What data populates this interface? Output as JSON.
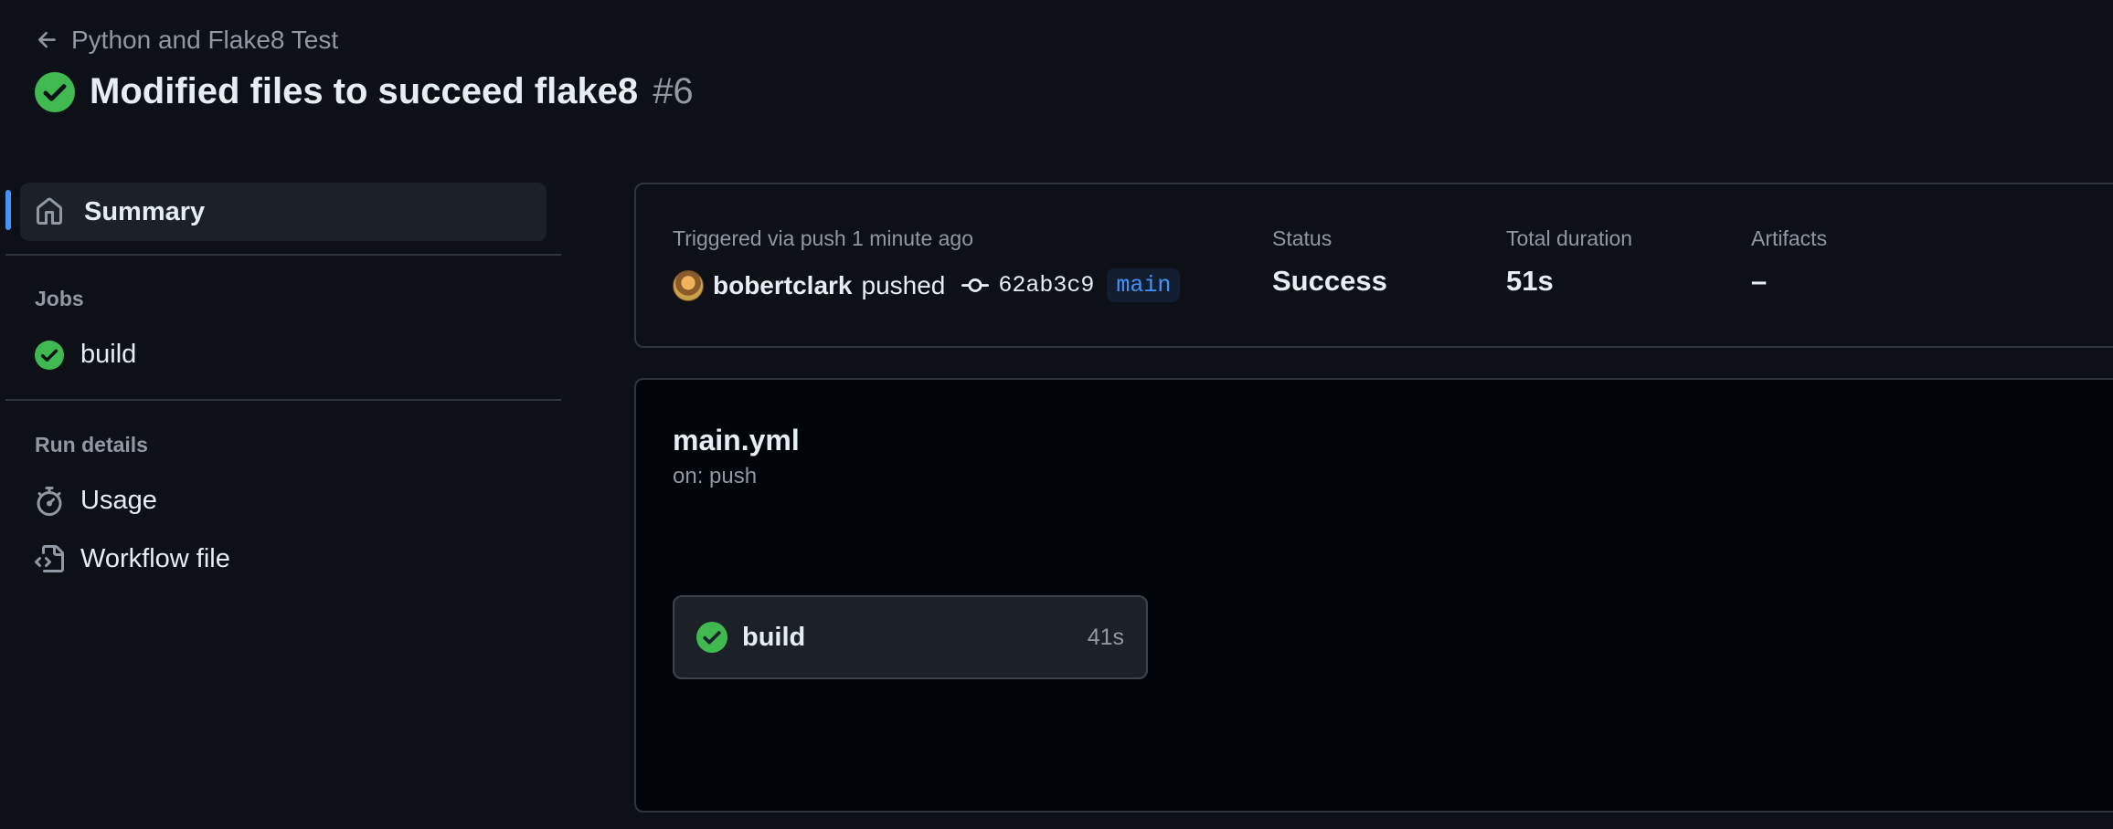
{
  "header": {
    "back_label": "Python and Flake8 Test",
    "run_title": "Modified files to succeed flake8",
    "run_number": "#6"
  },
  "sidebar": {
    "summary_label": "Summary",
    "jobs_heading": "Jobs",
    "jobs": [
      {
        "label": "build",
        "status": "success"
      }
    ],
    "run_details_heading": "Run details",
    "run_details": [
      {
        "label": "Usage",
        "icon": "stopwatch-icon"
      },
      {
        "label": "Workflow file",
        "icon": "file-code-icon"
      }
    ]
  },
  "summary": {
    "trigger_text": "Triggered via push 1 minute ago",
    "actor": "bobertclark",
    "action": "pushed",
    "commit_sha": "62ab3c9",
    "branch": "main",
    "status_label": "Status",
    "status_value": "Success",
    "duration_label": "Total duration",
    "duration_value": "51s",
    "artifacts_label": "Artifacts",
    "artifacts_value": "–"
  },
  "workflow": {
    "file_name": "main.yml",
    "trigger": "on: push",
    "jobs": [
      {
        "name": "build",
        "duration": "41s",
        "status": "success"
      }
    ]
  },
  "colors": {
    "background": "#0d1117",
    "success": "#3fb950",
    "accent": "#4493f8",
    "muted": "#9198a1",
    "border": "#30363d"
  }
}
